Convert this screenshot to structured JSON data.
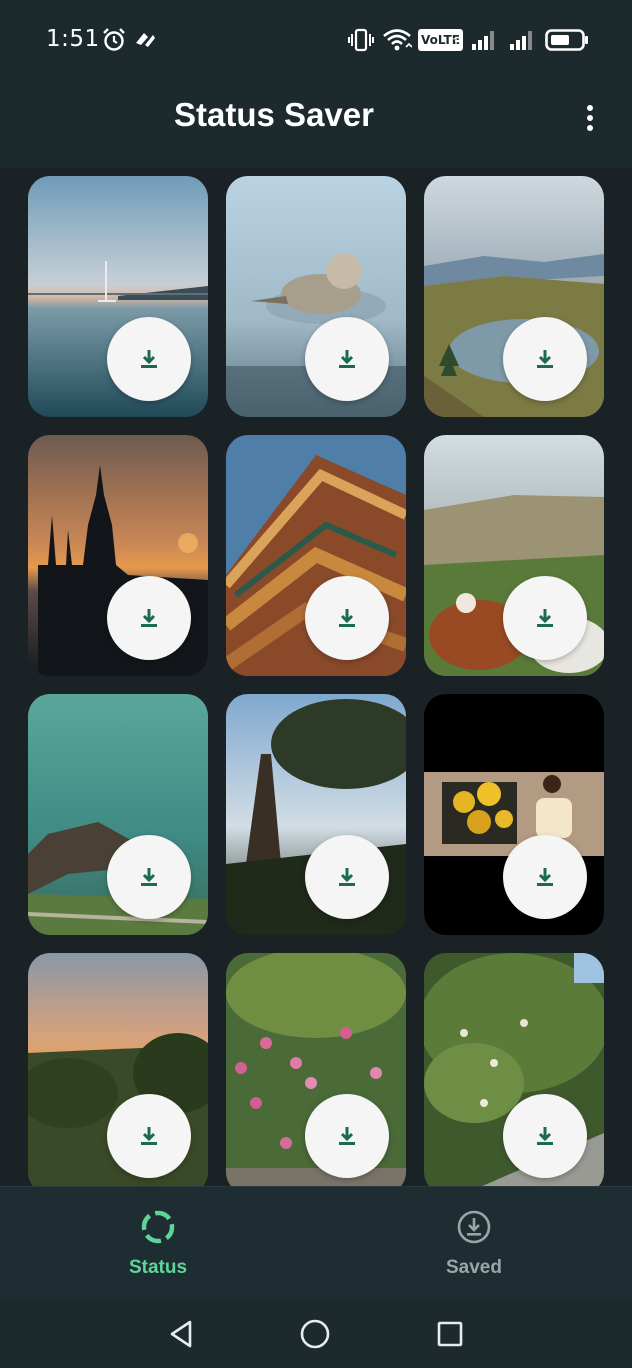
{
  "status_bar": {
    "time": "1:51",
    "icons": [
      "alarm-icon",
      "app-notification-icon",
      "vibrate-icon",
      "wifi-icon",
      "volte-badge",
      "signal-icon",
      "signal-icon",
      "battery-icon"
    ],
    "volte": "VoLTE",
    "sim_index": "1"
  },
  "app_bar": {
    "title": "Status Saver",
    "menu_icon": "more-vert-icon"
  },
  "grid": {
    "items": [
      {
        "scene": "calm lake sunset with sailboat",
        "action_icon": "download-icon"
      },
      {
        "scene": "shorebird on water",
        "action_icon": "download-icon"
      },
      {
        "scene": "mountain lake with pine tree",
        "action_icon": "download-icon"
      },
      {
        "scene": "cathedral silhouette at sunset",
        "action_icon": "download-icon"
      },
      {
        "scene": "chinese pagoda roof",
        "action_icon": "download-icon"
      },
      {
        "scene": "horses on grassy hills",
        "action_icon": "download-icon"
      },
      {
        "scene": "turquoise sea and rocky coast",
        "action_icon": "download-icon"
      },
      {
        "scene": "tree by the coast",
        "action_icon": "download-icon"
      },
      {
        "scene": "woman with sunflower painting",
        "action_icon": "download-icon"
      },
      {
        "scene": "city sunset over hills",
        "action_icon": "download-icon"
      },
      {
        "scene": "pink flowering bush",
        "action_icon": "download-icon"
      },
      {
        "scene": "garden with shrubs and path",
        "action_icon": "download-icon"
      }
    ]
  },
  "bottom_nav": {
    "tabs": [
      {
        "label": "Status",
        "icon": "status-ring-icon",
        "active": true
      },
      {
        "label": "Saved",
        "icon": "saved-download-icon",
        "active": false
      }
    ],
    "active_color": "#5fd39a",
    "inactive_color": "#9aa5a8"
  },
  "system_nav": [
    "back-icon",
    "home-icon",
    "recents-icon"
  ]
}
